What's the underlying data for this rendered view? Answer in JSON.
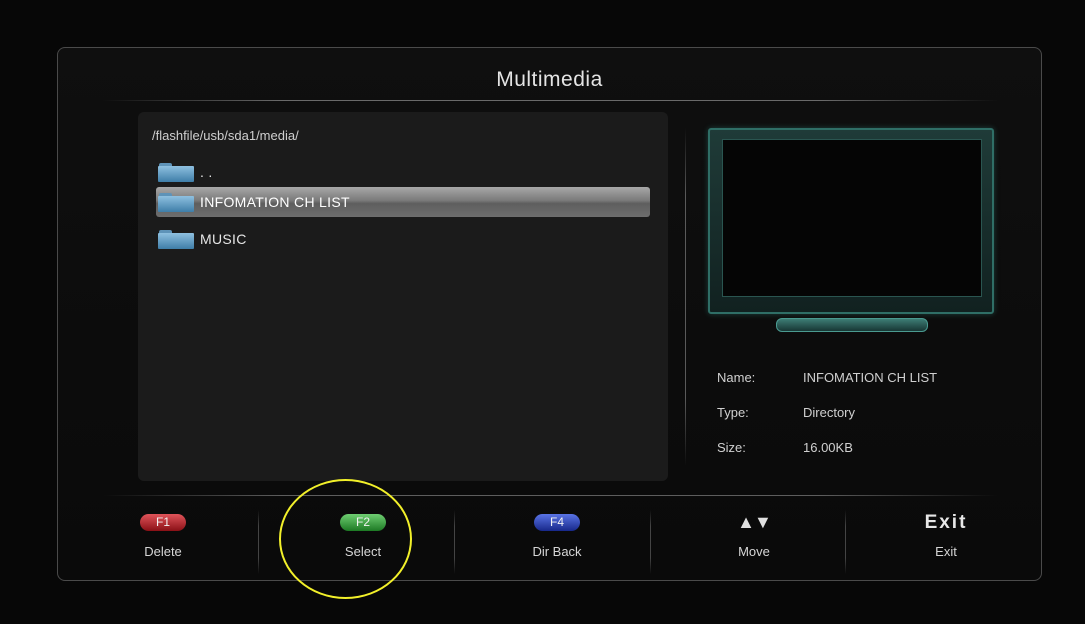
{
  "window": {
    "title": "Multimedia"
  },
  "browser": {
    "path": "/flashfile/usb/sda1/media/",
    "items": [
      {
        "label": ". .",
        "icon": "folder-icon",
        "selected": false
      },
      {
        "label": "INFOMATION CH LIST",
        "icon": "folder-icon",
        "selected": true
      },
      {
        "label": "MUSIC",
        "icon": "folder-icon",
        "selected": false
      }
    ]
  },
  "preview": {
    "icon": "tv-icon"
  },
  "info": {
    "name_label": "Name:",
    "name_value": "INFOMATION CH LIST",
    "type_label": "Type:",
    "type_value": "Directory",
    "size_label": "Size:",
    "size_value": "16.00KB"
  },
  "keys": [
    {
      "key": "F1",
      "label": "Delete",
      "color": "#c8262e"
    },
    {
      "key": "F2",
      "label": "Select",
      "color": "#36a83c"
    },
    {
      "key": "F4",
      "label": "Dir Back",
      "color": "#2c44c8"
    },
    {
      "key": "▲▼",
      "label": "Move"
    },
    {
      "key": "Exit",
      "label": "Exit"
    }
  ],
  "annotation": {
    "color": "#f2f02a"
  }
}
